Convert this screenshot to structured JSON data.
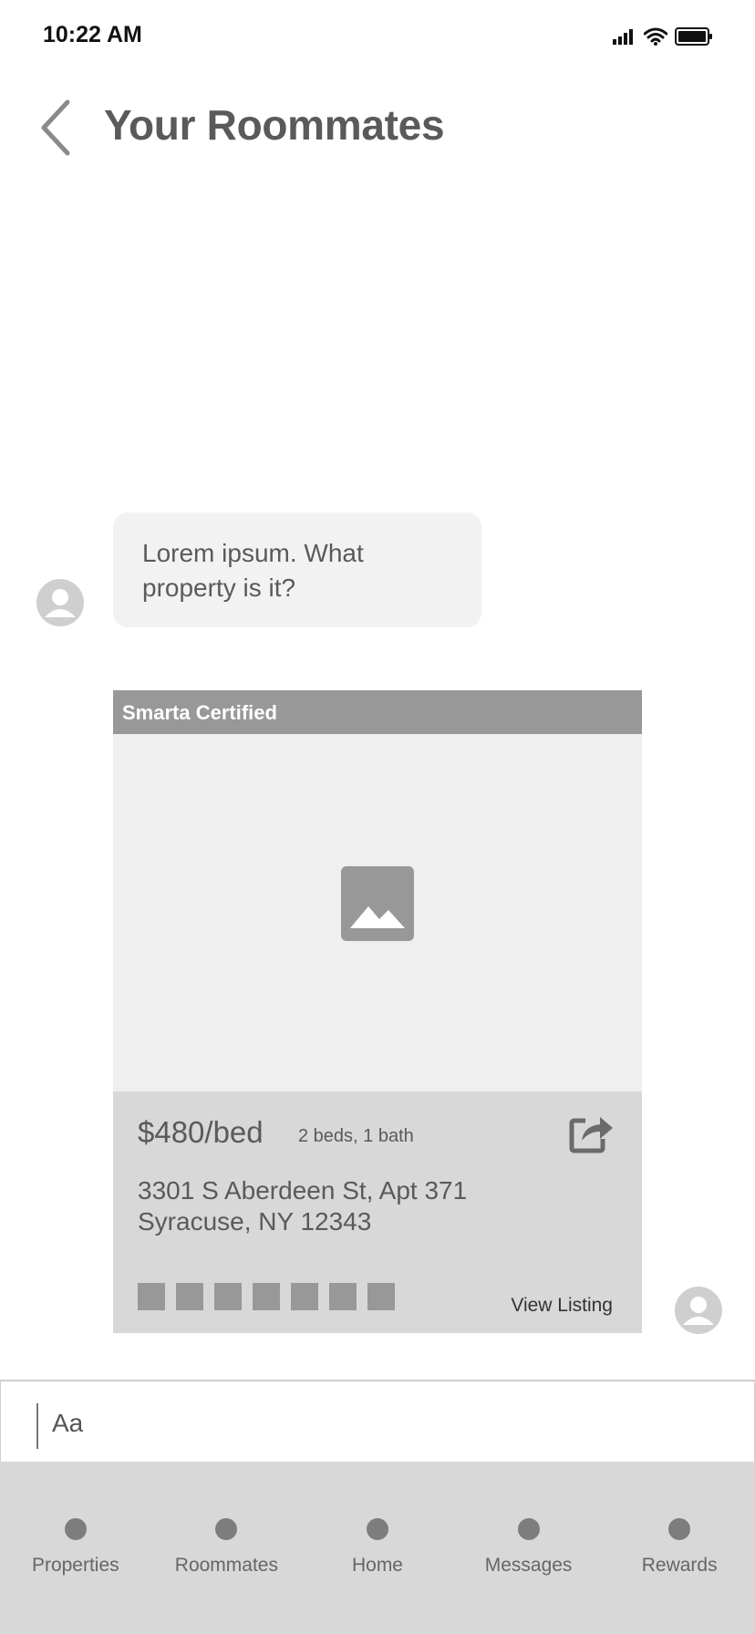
{
  "status_bar": {
    "time": "10:22 AM"
  },
  "header": {
    "title": "Your Roommates"
  },
  "chat": {
    "incoming_message": "Lorem ipsum. What property is it?"
  },
  "listing": {
    "badge": "Smarta Certified",
    "price": "$480/bed",
    "details": "2 beds, 1 bath",
    "address_line1": "3301 S Aberdeen St, Apt 371",
    "address_line2": "Syracuse, NY 12343",
    "view_label": "View Listing",
    "icons": {
      "image": "image-placeholder-icon",
      "share": "share-icon"
    }
  },
  "composer": {
    "placeholder": "Aa"
  },
  "tabbar": {
    "items": [
      {
        "label": "Properties"
      },
      {
        "label": "Roommates"
      },
      {
        "label": "Home"
      },
      {
        "label": "Messages"
      },
      {
        "label": "Rewards"
      }
    ]
  }
}
